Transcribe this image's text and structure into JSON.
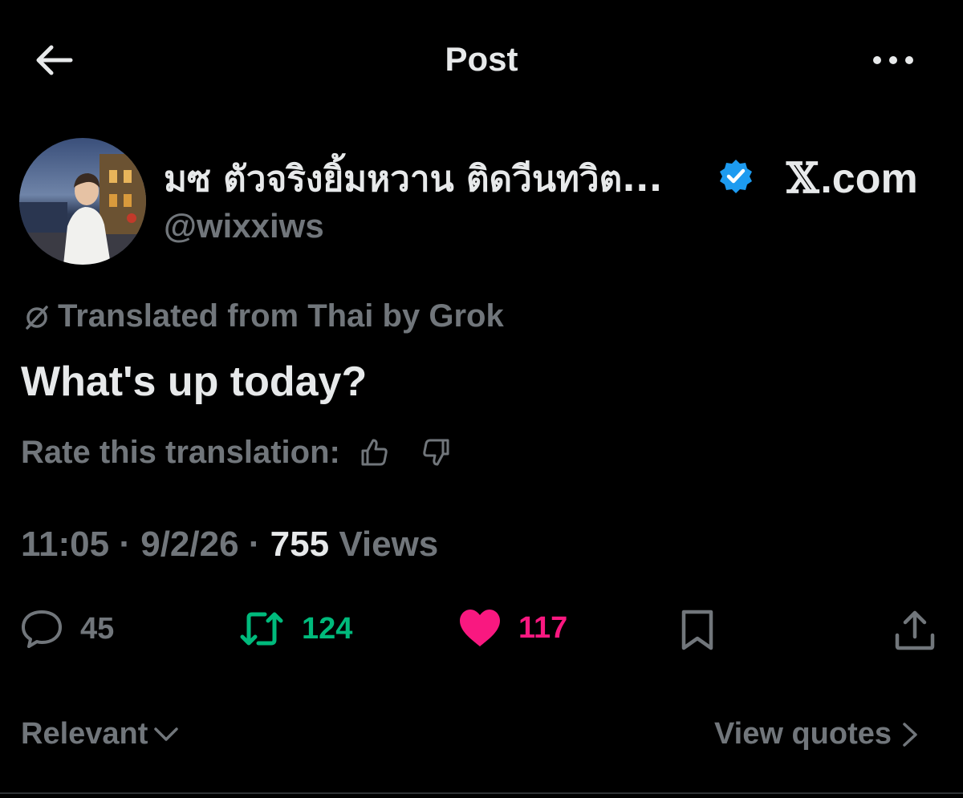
{
  "header": {
    "title": "Post",
    "back_icon": "arrow-left-icon",
    "more_icon": "more-horizontal-icon"
  },
  "author": {
    "display_name": "มซ ตัวจริงยิ้มหวาน ติดวีนทวิต...",
    "handle": "@wixxiws",
    "verified": true,
    "verified_color": "#1d9bf0"
  },
  "brand": {
    "text": ".com",
    "mark": "𝕏"
  },
  "translation": {
    "notice": "Translated from Thai by Grok",
    "text": "What's up today?",
    "rate_label": "Rate this translation:"
  },
  "meta": {
    "time": "11:05",
    "date": "9/2/26",
    "views_count": "755",
    "views_label": "Views",
    "separator": " · "
  },
  "actions": {
    "replies": "45",
    "reposts": "124",
    "likes": "117",
    "repost_color": "#00ba7c",
    "like_color": "#f91880"
  },
  "footer": {
    "relevant_label": "Relevant",
    "view_quotes_label": "View quotes"
  }
}
